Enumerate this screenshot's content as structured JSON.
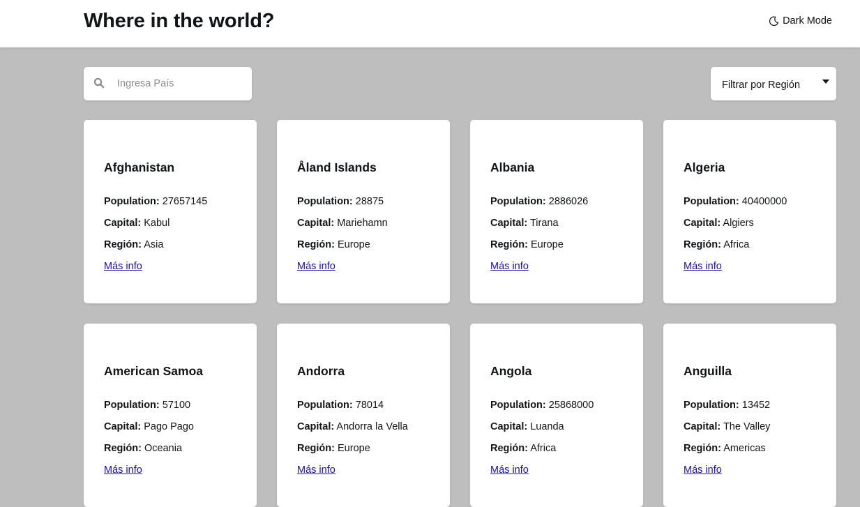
{
  "header": {
    "title": "Where in the world?",
    "dark_mode_label": "Dark Mode"
  },
  "search": {
    "placeholder": "Ingresa País",
    "value": ""
  },
  "filter": {
    "label": "Filtrar por Región"
  },
  "labels": {
    "population": "Population:",
    "capital": "Capital:",
    "region": "Región:",
    "more_info": "Más info"
  },
  "countries": [
    {
      "name": "Afghanistan",
      "population": "27657145",
      "capital": "Kabul",
      "region": "Asia"
    },
    {
      "name": "Åland Islands",
      "population": "28875",
      "capital": "Mariehamn",
      "region": "Europe"
    },
    {
      "name": "Albania",
      "population": "2886026",
      "capital": "Tirana",
      "region": "Europe"
    },
    {
      "name": "Algeria",
      "population": "40400000",
      "capital": "Algiers",
      "region": "Africa"
    },
    {
      "name": "American Samoa",
      "population": "57100",
      "capital": "Pago Pago",
      "region": "Oceania"
    },
    {
      "name": "Andorra",
      "population": "78014",
      "capital": "Andorra la Vella",
      "region": "Europe"
    },
    {
      "name": "Angola",
      "population": "25868000",
      "capital": "Luanda",
      "region": "Africa"
    },
    {
      "name": "Anguilla",
      "population": "13452",
      "capital": "The Valley",
      "region": "Americas"
    }
  ]
}
